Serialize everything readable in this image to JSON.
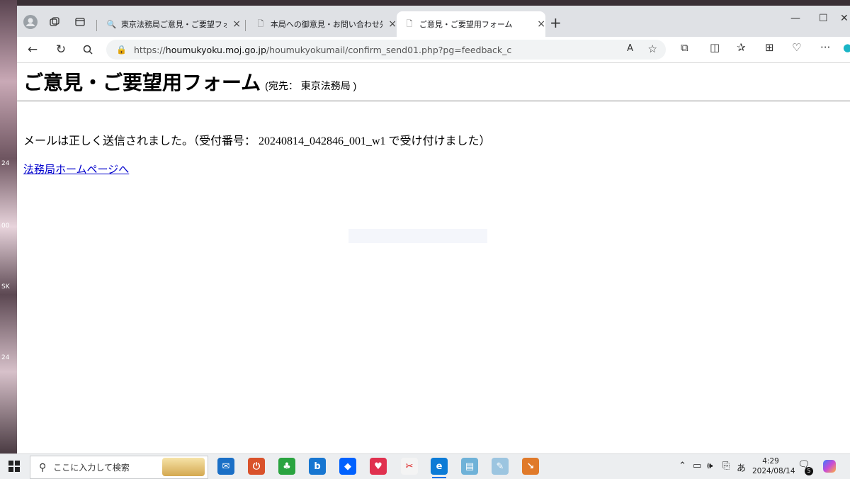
{
  "desktop": {
    "fragments": [
      "24",
      "00",
      "SK",
      "24"
    ]
  },
  "browser": {
    "tabs": [
      {
        "label": "東京法務局ご意見・ご要望フォーム -",
        "icon": "search-icon",
        "active": false
      },
      {
        "label": "本局への御意見・お問い合わせ先ー",
        "icon": "page-icon",
        "active": false
      },
      {
        "label": "ご意見・ご要望用フォーム",
        "icon": "page-icon",
        "active": true
      }
    ],
    "new_tab_glyph": "+",
    "url_prefix": "https://",
    "url_host": "houmukyoku.moj.go.jp",
    "url_path": "/houmukyokumail/confirm_send01.php?pg=feedback_c",
    "read_aloud_label": "A"
  },
  "page": {
    "title": "ご意見・ご要望用フォーム",
    "subtitle": "(宛先： 東京法務局 )",
    "message": "メールは正しく送信されました。（受付番号： 20240814_042846_001_w1 で受け付けました）",
    "home_link": "法務局ホームページへ"
  },
  "taskbar": {
    "search_placeholder": "ここに入力して検索",
    "ime": "あ",
    "time": "4:29",
    "date": "2024/08/14",
    "notification_count": "5"
  },
  "colors": {
    "link": "#0000cc",
    "tab_bar": "#dfe1e5",
    "taskbar": "#eceef0"
  }
}
